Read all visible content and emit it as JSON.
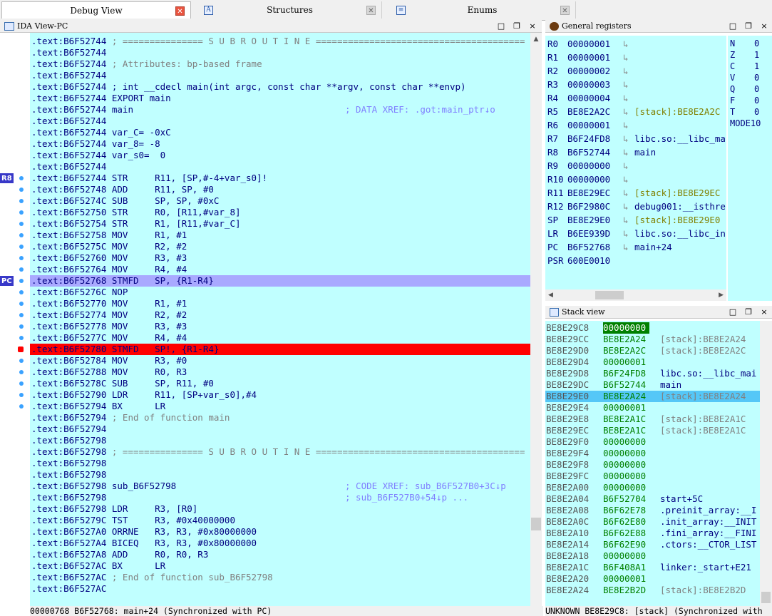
{
  "tabs": [
    {
      "label": "Debug View",
      "active": true
    },
    {
      "label": "Structures",
      "active": false
    },
    {
      "label": "Enums",
      "active": false
    }
  ],
  "ida_view": {
    "title": "IDA View-PC",
    "markers": {
      "r8": "R8",
      "pc": "PC"
    },
    "lines": [
      {
        "addr": ".text:B6F52744",
        "text": " ; =============== S U B R O U T I N E =======================================",
        "kind": "cmt"
      },
      {
        "addr": ".text:B6F52744",
        "text": "",
        "kind": "plain"
      },
      {
        "addr": ".text:B6F52744",
        "text": " ; Attributes: bp-based frame",
        "kind": "cmt"
      },
      {
        "addr": ".text:B6F52744",
        "text": "",
        "kind": "plain"
      },
      {
        "addr": ".text:B6F52744",
        "text": " ; int __cdecl main(int argc, const char **argv, const char **envp)",
        "kind": "kw"
      },
      {
        "addr": ".text:B6F52744",
        "text": " EXPORT main",
        "kind": "kw"
      },
      {
        "addr": ".text:B6F52744",
        "text": " main",
        "kind": "plain",
        "xref": "; DATA XREF: .got:main_ptr↓o"
      },
      {
        "addr": ".text:B6F52744",
        "text": "",
        "kind": "plain"
      },
      {
        "addr": ".text:B6F52744",
        "text": " var_C= -0xC",
        "kind": "plain"
      },
      {
        "addr": ".text:B6F52744",
        "text": " var_8= -8",
        "kind": "plain"
      },
      {
        "addr": ".text:B6F52744",
        "text": " var_s0=  0",
        "kind": "plain"
      },
      {
        "addr": ".text:B6F52744",
        "text": "",
        "kind": "plain"
      },
      {
        "addr": ".text:B6F52744",
        "text": " STR     R11, [SP,#-4+var_s0]!",
        "kind": "plain",
        "dot": true,
        "marker": "r8"
      },
      {
        "addr": ".text:B6F52748",
        "text": " ADD     R11, SP, #0",
        "kind": "plain",
        "dot": true
      },
      {
        "addr": ".text:B6F5274C",
        "text": " SUB     SP, SP, #0xC",
        "kind": "plain",
        "dot": true
      },
      {
        "addr": ".text:B6F52750",
        "text": " STR     R0, [R11,#var_8]",
        "kind": "plain",
        "dot": true
      },
      {
        "addr": ".text:B6F52754",
        "text": " STR     R1, [R11,#var_C]",
        "kind": "plain",
        "dot": true
      },
      {
        "addr": ".text:B6F52758",
        "text": " MOV     R1, #1",
        "kind": "plain",
        "dot": true
      },
      {
        "addr": ".text:B6F5275C",
        "text": " MOV     R2, #2",
        "kind": "plain",
        "dot": true
      },
      {
        "addr": ".text:B6F52760",
        "text": " MOV     R3, #3",
        "kind": "plain",
        "dot": true
      },
      {
        "addr": ".text:B6F52764",
        "text": " MOV     R4, #4",
        "kind": "plain",
        "dot": true
      },
      {
        "addr": ".text:B6F52768",
        "text": " STMFD   SP, {R1-R4}",
        "kind": "plain",
        "dot": true,
        "marker": "pc",
        "hl": "pc"
      },
      {
        "addr": ".text:B6F5276C",
        "text": " NOP",
        "kind": "plain",
        "dot": true
      },
      {
        "addr": ".text:B6F52770",
        "text": " MOV     R1, #1",
        "kind": "plain",
        "dot": true
      },
      {
        "addr": ".text:B6F52774",
        "text": " MOV     R2, #2",
        "kind": "plain",
        "dot": true
      },
      {
        "addr": ".text:B6F52778",
        "text": " MOV     R3, #3",
        "kind": "plain",
        "dot": true
      },
      {
        "addr": ".text:B6F5277C",
        "text": " MOV     R4, #4",
        "kind": "plain",
        "dot": true
      },
      {
        "addr": ".text:B6F52780",
        "text": " STMFD   SP!, {R1-R4}",
        "kind": "plain",
        "bp": true,
        "hl": "bp"
      },
      {
        "addr": ".text:B6F52784",
        "text": " MOV     R3, #0",
        "kind": "plain",
        "dot": true
      },
      {
        "addr": ".text:B6F52788",
        "text": " MOV     R0, R3",
        "kind": "plain",
        "dot": true
      },
      {
        "addr": ".text:B6F5278C",
        "text": " SUB     SP, R11, #0",
        "kind": "plain",
        "dot": true
      },
      {
        "addr": ".text:B6F52790",
        "text": " LDR     R11, [SP+var_s0],#4",
        "kind": "plain",
        "dot": true
      },
      {
        "addr": ".text:B6F52794",
        "text": " BX      LR",
        "kind": "plain",
        "dot": true
      },
      {
        "addr": ".text:B6F52794",
        "text": " ; End of function main",
        "kind": "cmt"
      },
      {
        "addr": ".text:B6F52794",
        "text": "",
        "kind": "plain"
      },
      {
        "addr": ".text:B6F52798",
        "text": "",
        "kind": "plain"
      },
      {
        "addr": ".text:B6F52798",
        "text": " ; =============== S U B R O U T I N E =======================================",
        "kind": "cmt"
      },
      {
        "addr": ".text:B6F52798",
        "text": "",
        "kind": "plain"
      },
      {
        "addr": ".text:B6F52798",
        "text": "",
        "kind": "plain"
      },
      {
        "addr": ".text:B6F52798",
        "text": " sub_B6F52798",
        "kind": "plain",
        "xref": "; CODE XREF: sub_B6F527B0+3C↓p"
      },
      {
        "addr": ".text:B6F52798",
        "text": "",
        "kind": "plain",
        "xref": "; sub_B6F527B0+54↓p ..."
      },
      {
        "addr": ".text:B6F52798",
        "text": " LDR     R3, [R0]",
        "kind": "plain"
      },
      {
        "addr": ".text:B6F5279C",
        "text": " TST     R3, #0x40000000",
        "kind": "plain"
      },
      {
        "addr": ".text:B6F527A0",
        "text": " ORRNE   R3, R3, #0x80000000",
        "kind": "plain"
      },
      {
        "addr": ".text:B6F527A4",
        "text": " BICEQ   R3, R3, #0x80000000",
        "kind": "plain"
      },
      {
        "addr": ".text:B6F527A8",
        "text": " ADD     R0, R0, R3",
        "kind": "plain"
      },
      {
        "addr": ".text:B6F527AC",
        "text": " BX      LR",
        "kind": "plain"
      },
      {
        "addr": ".text:B6F527AC",
        "text": " ; End of function sub_B6F52798",
        "kind": "cmt"
      },
      {
        "addr": ".text:B6F527AC",
        "text": "",
        "kind": "plain"
      }
    ],
    "status": "00000768 B6F52768: main+24 (Synchronized with PC)"
  },
  "registers": {
    "title": "General registers",
    "rows": [
      {
        "name": "R0",
        "value": "00000001",
        "arrow": true,
        "desc": ""
      },
      {
        "name": "R1",
        "value": "00000001",
        "arrow": true,
        "desc": ""
      },
      {
        "name": "R2",
        "value": "00000002",
        "arrow": true,
        "desc": ""
      },
      {
        "name": "R3",
        "value": "00000003",
        "arrow": true,
        "desc": ""
      },
      {
        "name": "R4",
        "value": "00000004",
        "arrow": true,
        "desc": ""
      },
      {
        "name": "R5",
        "value": "BE8E2A2C",
        "arrow": true,
        "desc": "[stack]:BE8E2A2C"
      },
      {
        "name": "R6",
        "value": "00000001",
        "arrow": true,
        "desc": ""
      },
      {
        "name": "R7",
        "value": "B6F24FD8",
        "arrow": true,
        "desc": "libc.so:__libc_ma"
      },
      {
        "name": "R8",
        "value": "B6F52744",
        "arrow": true,
        "desc": "main"
      },
      {
        "name": "R9",
        "value": "00000000",
        "arrow": true,
        "desc": ""
      },
      {
        "name": "R10",
        "value": "00000000",
        "arrow": true,
        "desc": ""
      },
      {
        "name": "R11",
        "value": "BE8E29EC",
        "arrow": true,
        "desc": "[stack]:BE8E29EC"
      },
      {
        "name": "R12",
        "value": "B6F2980C",
        "arrow": true,
        "desc": "debug001:__isthre"
      },
      {
        "name": "SP",
        "value": "BE8E29E0",
        "arrow": true,
        "desc": "[stack]:BE8E29E0"
      },
      {
        "name": "LR",
        "value": "B6EE939D",
        "arrow": true,
        "desc": "libc.so:__libc_in"
      },
      {
        "name": "PC",
        "value": "B6F52768",
        "arrow": true,
        "desc": "main+24"
      },
      {
        "name": "PSR",
        "value": "600E0010",
        "arrow": false,
        "desc": ""
      }
    ],
    "flags": [
      {
        "name": "N",
        "value": "0"
      },
      {
        "name": "Z",
        "value": "1"
      },
      {
        "name": "C",
        "value": "1"
      },
      {
        "name": "V",
        "value": "0"
      },
      {
        "name": "Q",
        "value": "0"
      },
      {
        "name": "F",
        "value": "0"
      },
      {
        "name": "T",
        "value": "0"
      },
      {
        "name": "MODE",
        "value": "10"
      }
    ]
  },
  "stack": {
    "title": "Stack view",
    "rows": [
      {
        "addr": "BE8E29C8",
        "value": "00000000",
        "desc": "",
        "valhl": true
      },
      {
        "addr": "BE8E29CC",
        "value": "BE8E2A24",
        "desc": "[stack]:BE8E2A24"
      },
      {
        "addr": "BE8E29D0",
        "value": "BE8E2A2C",
        "desc": "[stack]:BE8E2A2C"
      },
      {
        "addr": "BE8E29D4",
        "value": "00000001",
        "desc": ""
      },
      {
        "addr": "BE8E29D8",
        "value": "B6F24FD8",
        "desc": "libc.so:__libc_mai"
      },
      {
        "addr": "BE8E29DC",
        "value": "B6F52744",
        "desc": "main"
      },
      {
        "addr": "BE8E29E0",
        "value": "BE8E2A24",
        "desc": "[stack]:BE8E2A24",
        "rowhl": true
      },
      {
        "addr": "BE8E29E4",
        "value": "00000001",
        "desc": ""
      },
      {
        "addr": "BE8E29E8",
        "value": "BE8E2A1C",
        "desc": "[stack]:BE8E2A1C"
      },
      {
        "addr": "BE8E29EC",
        "value": "BE8E2A1C",
        "desc": "[stack]:BE8E2A1C"
      },
      {
        "addr": "BE8E29F0",
        "value": "00000000",
        "desc": ""
      },
      {
        "addr": "BE8E29F4",
        "value": "00000000",
        "desc": ""
      },
      {
        "addr": "BE8E29F8",
        "value": "00000000",
        "desc": ""
      },
      {
        "addr": "BE8E29FC",
        "value": "00000000",
        "desc": ""
      },
      {
        "addr": "BE8E2A00",
        "value": "00000000",
        "desc": ""
      },
      {
        "addr": "BE8E2A04",
        "value": "B6F52704",
        "desc": "start+5C"
      },
      {
        "addr": "BE8E2A08",
        "value": "B6F62E78",
        "desc": ".preinit_array:__I"
      },
      {
        "addr": "BE8E2A0C",
        "value": "B6F62E80",
        "desc": ".init_array:__INIT"
      },
      {
        "addr": "BE8E2A10",
        "value": "B6F62E88",
        "desc": ".fini_array:__FINI"
      },
      {
        "addr": "BE8E2A14",
        "value": "B6F62E90",
        "desc": ".ctors:__CTOR_LIST"
      },
      {
        "addr": "BE8E2A18",
        "value": "00000000",
        "desc": ""
      },
      {
        "addr": "BE8E2A1C",
        "value": "B6F408A1",
        "desc": "linker:_start+E21"
      },
      {
        "addr": "BE8E2A20",
        "value": "00000001",
        "desc": ""
      },
      {
        "addr": "BE8E2A24",
        "value": "BE8E2B2D",
        "desc": "[stack]:BE8E2B2D"
      }
    ],
    "status": "UNKNOWN BE8E29C8: [stack] (Synchronized with"
  },
  "colors": {
    "code_bg": "#c0ffff",
    "pc_highlight": "#a9a9ff",
    "breakpoint": "#ff0000",
    "stack_row_highlight": "#55c7f7"
  },
  "icons": {
    "close": "×",
    "minimize": "□",
    "restore": "❐",
    "arrow": "↳"
  }
}
